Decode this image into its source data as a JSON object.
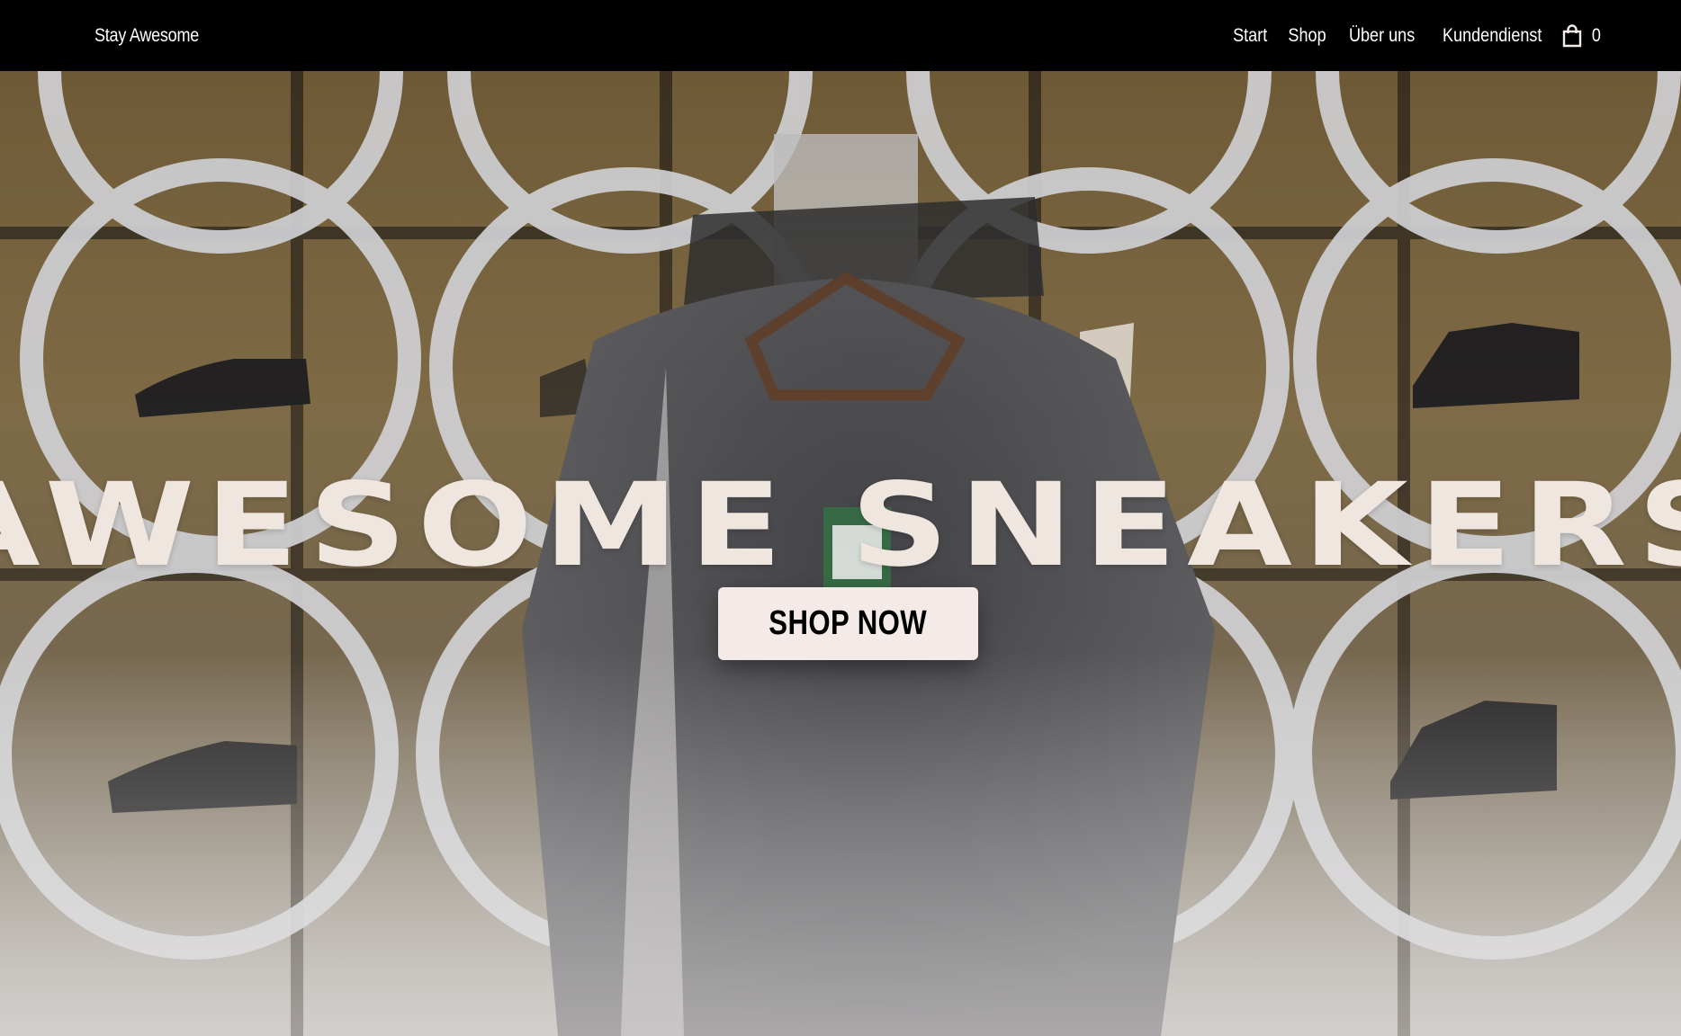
{
  "nav": {
    "brand": "Stay Awesome",
    "links": [
      "Start",
      "Shop",
      "Über uns",
      "Kundendienst"
    ],
    "cart_icon": "shopping-bag-icon",
    "cart_count": "0"
  },
  "hero": {
    "title": "AWESOME SNEAKERS",
    "cta_label": "SHOP NOW",
    "background": "photo of sneaker store wall with circular shelves and clothing rack"
  },
  "colors": {
    "nav_bg": "#000000",
    "nav_text": "#ffffff",
    "title": "#efe6df",
    "cta_bg": "#f4ebe9",
    "cta_text": "#000000"
  }
}
